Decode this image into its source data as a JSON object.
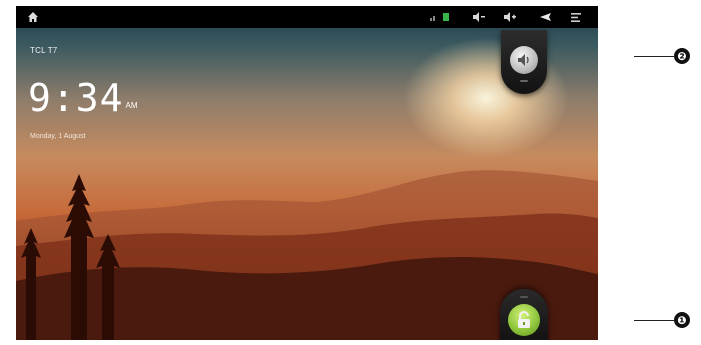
{
  "status_bar": {
    "icons": [
      "home-icon",
      "signal-icon",
      "network-icon",
      "volume-down-icon",
      "volume-up-icon",
      "share-icon",
      "menu-icon"
    ]
  },
  "lockscreen": {
    "carrier": "TCL T7",
    "time": "9:34",
    "ampm": "AM",
    "date": "Monday, 1 August",
    "sound_toggle_icon": "speaker-icon",
    "unlock_icon": "unlock-padlock-icon"
  },
  "callouts": [
    "❷",
    "❶"
  ]
}
